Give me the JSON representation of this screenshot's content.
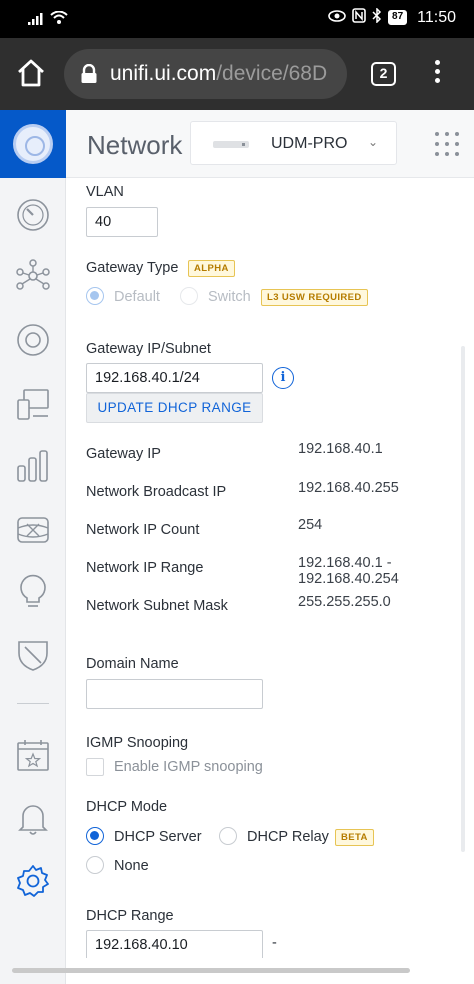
{
  "status_bar": {
    "time": "11:50",
    "battery": "87"
  },
  "browser": {
    "url_domain": "unifi.ui.com",
    "url_path": "/device/68D",
    "tab_count": "2"
  },
  "header": {
    "title": "Network",
    "device_name": "UDM-PRO"
  },
  "sidebar": {
    "icons": [
      "unifi-logo-icon",
      "dashboard-icon",
      "topology-icon",
      "devices-icon",
      "clients-icon",
      "statistics-icon",
      "insights-icon",
      "hotspot-icon",
      "security-icon",
      "events-icon",
      "alerts-icon",
      "settings-icon"
    ]
  },
  "form": {
    "vlan_label": "VLAN",
    "vlan_value": "40",
    "gateway_type_label": "Gateway Type",
    "alpha_badge": "ALPHA",
    "gateway_default": "Default",
    "gateway_switch": "Switch",
    "l3_badge": "L3 USW REQUIRED",
    "gateway_subnet_label": "Gateway IP/Subnet",
    "gateway_subnet_value": "192.168.40.1/24",
    "update_dhcp_range": "UPDATE DHCP RANGE",
    "info_glyph": "i",
    "details": [
      {
        "label": "Gateway IP",
        "value": "192.168.40.1"
      },
      {
        "label": "Network Broadcast IP",
        "value": "192.168.40.255"
      },
      {
        "label": "Network IP Count",
        "value": "254"
      },
      {
        "label": "Network IP Range",
        "value": "192.168.40.1 -",
        "value2": "192.168.40.254"
      },
      {
        "label": "Network Subnet Mask",
        "value": "255.255.255.0"
      }
    ],
    "domain_name_label": "Domain Name",
    "domain_name_value": "",
    "igmp_label": "IGMP Snooping",
    "igmp_checkbox_label": "Enable IGMP snooping",
    "dhcp_mode_label": "DHCP Mode",
    "dhcp_server": "DHCP Server",
    "dhcp_relay": "DHCP Relay",
    "beta_badge": "BETA",
    "dhcp_none": "None",
    "dhcp_range_label": "DHCP Range",
    "dhcp_range_start": "192.168.40.10",
    "dhcp_range_sep": "-"
  }
}
